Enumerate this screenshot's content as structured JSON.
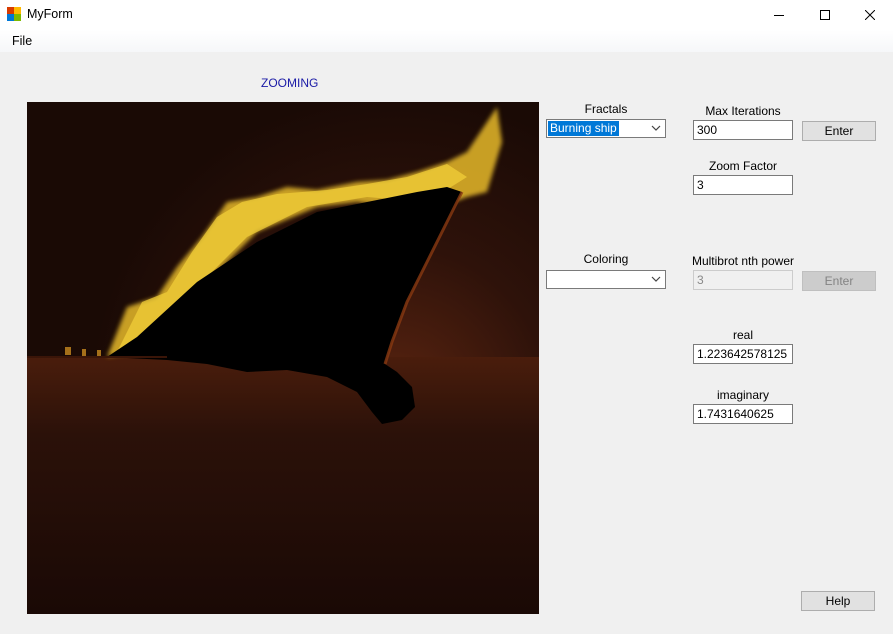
{
  "window": {
    "title": "MyForm"
  },
  "menu": {
    "file_label": "File"
  },
  "status": {
    "text": "ZOOMING"
  },
  "fractals": {
    "label": "Fractals",
    "selected": "Burning ship"
  },
  "coloring": {
    "label": "Coloring",
    "selected": ""
  },
  "max_iterations": {
    "label": "Max Iterations",
    "value": "300",
    "button_label": "Enter"
  },
  "zoom_factor": {
    "label": "Zoom Factor",
    "value": "3"
  },
  "multibrot": {
    "label": "Multibrot nth power",
    "value": "3",
    "button_label": "Enter"
  },
  "real": {
    "label": "real",
    "value": "1.223642578125"
  },
  "imaginary": {
    "label": "imaginary",
    "value": "1.7431640625"
  },
  "help": {
    "button_label": "Help"
  },
  "colors": {
    "status": "#1a1aa6",
    "selection": "#0078d7",
    "fractal_bg": "#1a0a05",
    "fractal_gold": "#e6b92a"
  }
}
